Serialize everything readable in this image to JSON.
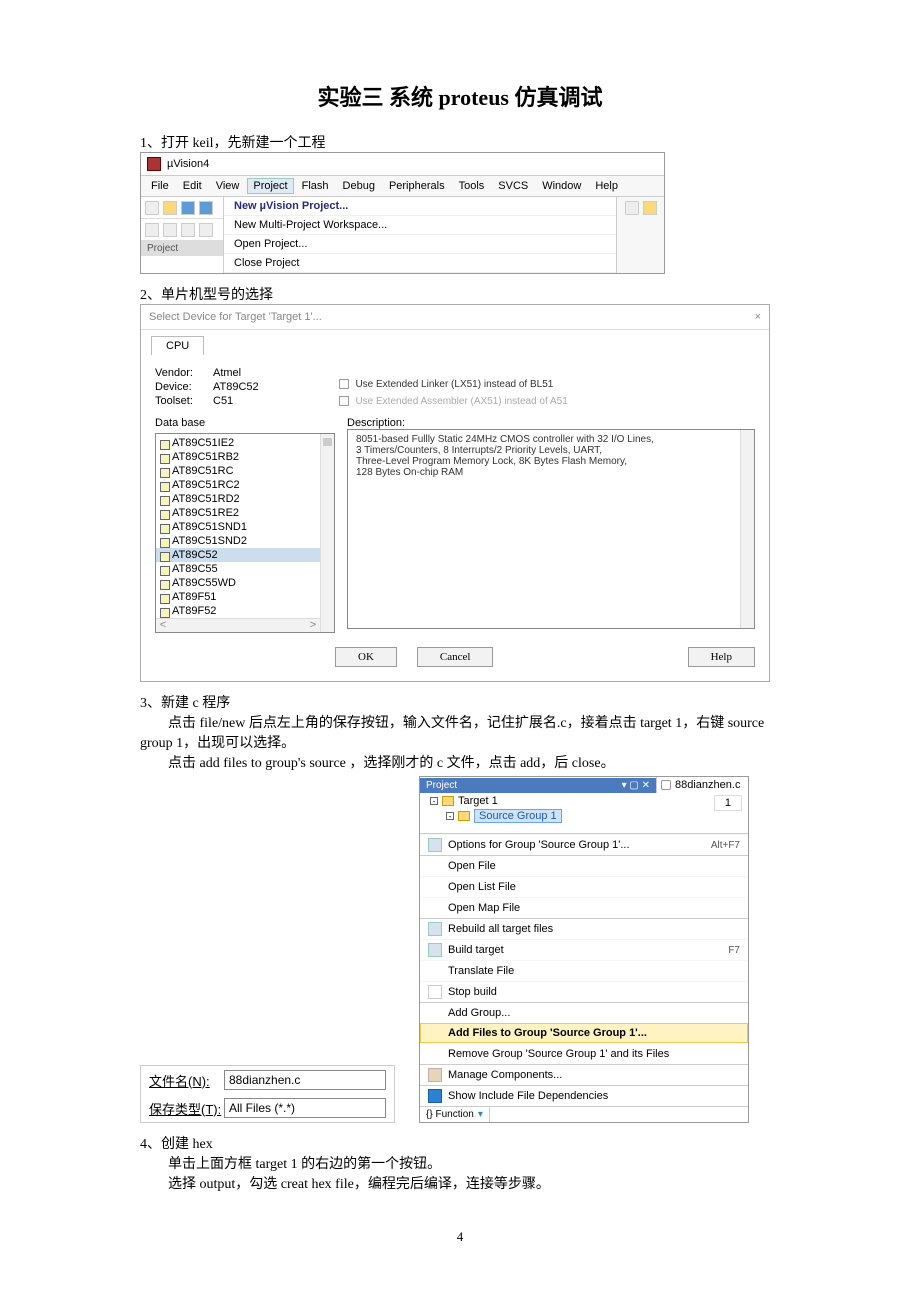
{
  "doc": {
    "title": "实验三 系统 proteus 仿真调试",
    "step1": "1、打开 keil，先新建一个工程",
    "step2": "2、单片机型号的选择",
    "step3": "3、新建 c 程序",
    "step3_p1": "点击 file/new 后点左上角的保存按钮，输入文件名，记住扩展名.c，接着点击 target 1，右键 source group 1，出现可以选择。",
    "step3_p2": "点击 add files to group's source ，选择刚才的 c 文件，点击 add，后 close。",
    "step4": "4、创建 hex",
    "step4_p1": "单击上面方框 target 1 的右边的第一个按钮。",
    "step4_p2": "选择 output，勾选 creat hex file，编程完后编译，连接等步骤。",
    "page_num": "4"
  },
  "shot1": {
    "app_title": "µVision4",
    "menus": [
      "File",
      "Edit",
      "View",
      "Project",
      "Flash",
      "Debug",
      "Peripherals",
      "Tools",
      "SVCS",
      "Window",
      "Help"
    ],
    "selected_menu_index": 3,
    "dropdown": {
      "new_project": "New µVision Project...",
      "new_multi": "New Multi-Project Workspace...",
      "open": "Open Project...",
      "close": "Close Project"
    },
    "left_panel_label": "Project"
  },
  "shot2": {
    "title": "Select Device for Target 'Target 1'...",
    "tab": "CPU",
    "vendor_label": "Vendor:",
    "vendor_value": "Atmel",
    "device_label": "Device:",
    "device_value": "AT89C52",
    "toolset_label": "Toolset:",
    "toolset_value": "C51",
    "chk_linker": "Use Extended Linker (LX51) instead of BL51",
    "chk_asm": "Use Extended Assembler (AX51) instead of A51",
    "data_base_label": "Data base",
    "description_label": "Description:",
    "devices": [
      "AT89C51IE2",
      "AT89C51RB2",
      "AT89C51RC",
      "AT89C51RC2",
      "AT89C51RD2",
      "AT89C51RE2",
      "AT89C51SND1",
      "AT89C51SND2",
      "AT89C52",
      "AT89C55",
      "AT89C55WD",
      "AT89F51",
      "AT89F52"
    ],
    "selected_device_index": 8,
    "description": "8051-based Fullly Static 24MHz CMOS controller with 32 I/O Lines,\n3 Timers/Counters, 8 Interrupts/2 Priority Levels, UART,\nThree-Level Program Memory Lock, 8K Bytes Flash Memory,\n128 Bytes On-chip RAM",
    "btn_ok": "OK",
    "btn_cancel": "Cancel",
    "btn_help": "Help"
  },
  "shot3a": {
    "filename_label": "文件名(N):",
    "filename_value": "88dianzhen.c",
    "type_label": "保存类型(T):",
    "type_value": "All Files (*.*)"
  },
  "shot3b": {
    "proj_panel_title": "Project",
    "proj_panel_controls": "▾  ▢  ✕",
    "file_tab": "88dianzhen.c",
    "tab2": "1",
    "tree_target": "Target 1",
    "tree_group": "Source Group 1",
    "menu": {
      "options": "Options for Group 'Source Group 1'...",
      "options_sc": "Alt+F7",
      "open_file": "Open File",
      "open_list": "Open List File",
      "open_map": "Open Map File",
      "rebuild": "Rebuild all target files",
      "build": "Build target",
      "build_sc": "F7",
      "translate": "Translate File",
      "stop": "Stop build",
      "add_group": "Add Group...",
      "add_files": "Add Files to Group 'Source Group 1'...",
      "remove_group": "Remove Group 'Source Group 1' and its Files",
      "manage": "Manage Components...",
      "show_incl": "Show Include File Dependencies"
    },
    "footer_tab": "{} Function"
  }
}
